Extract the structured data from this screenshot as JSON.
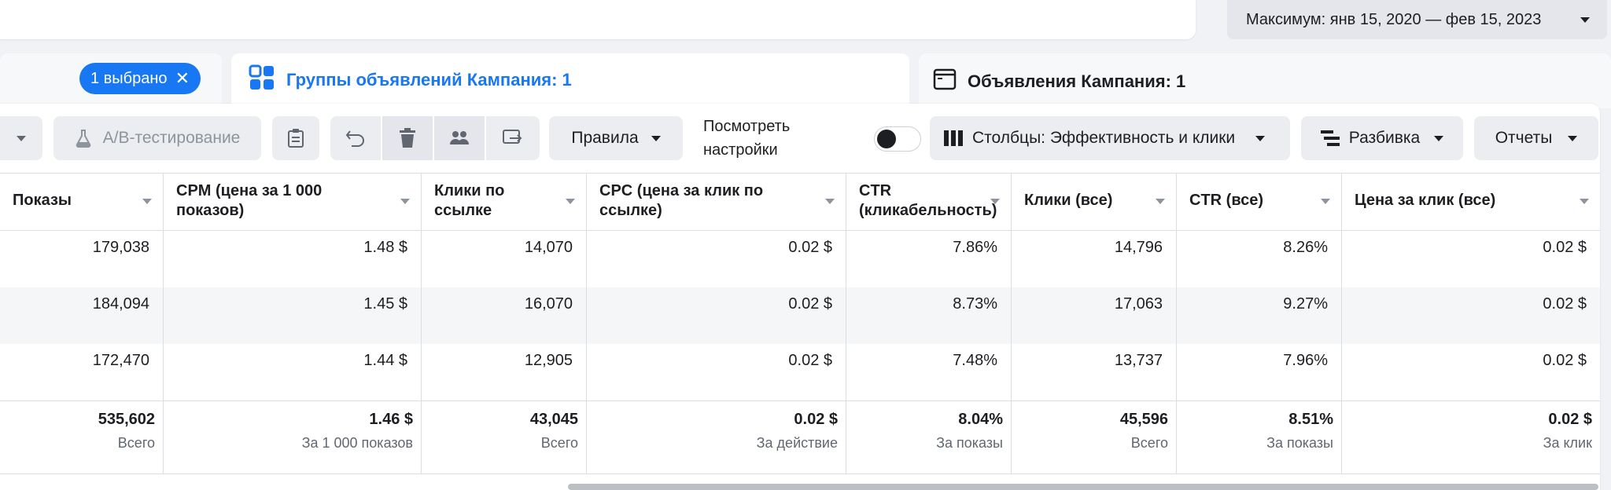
{
  "date_range": {
    "label": "Максимум: янв 15, 2020 — фев 15, 2023"
  },
  "tabs": {
    "campaigns": {
      "chip_label": "1 выбрано",
      "chip_close": "✕"
    },
    "adsets": {
      "title": "Группы объявлений Кампания: 1",
      "icon": "grid-icon"
    },
    "ads": {
      "title": "Объявления Кампания: 1",
      "icon": "window-icon"
    }
  },
  "toolbar": {
    "ab_test_label": "A/B-тестирование",
    "rules_label": "Правила",
    "view_settings_label_1": "Посмотреть",
    "view_settings_label_2": "настройки",
    "columns_label": "Столбцы: Эффективность и клики",
    "breakdown_label": "Разбивка",
    "reports_label": "Отчеты"
  },
  "table": {
    "columns": [
      "Показы",
      "CPM (цена за 1 000 показов)",
      "Клики по ссылке",
      "CPC (цена за клик по ссылке)",
      "CTR (кликабельность)",
      "Клики (все)",
      "CTR (все)",
      "Цена за клик (все)"
    ],
    "rows": [
      [
        "179,038",
        "1.48 $",
        "14,070",
        "0.02 $",
        "7.86%",
        "14,796",
        "8.26%",
        "0.02 $"
      ],
      [
        "184,094",
        "1.45 $",
        "16,070",
        "0.02 $",
        "8.73%",
        "17,063",
        "9.27%",
        "0.02 $"
      ],
      [
        "172,470",
        "1.44 $",
        "12,905",
        "0.02 $",
        "7.48%",
        "13,737",
        "7.96%",
        "0.02 $"
      ]
    ],
    "totals": [
      {
        "value": "535,602",
        "sub": "Всего"
      },
      {
        "value": "1.46 $",
        "sub": "За 1 000 показов"
      },
      {
        "value": "43,045",
        "sub": "Всего"
      },
      {
        "value": "0.02 $",
        "sub": "За действие"
      },
      {
        "value": "8.04%",
        "sub": "За показы"
      },
      {
        "value": "45,596",
        "sub": "Всего"
      },
      {
        "value": "8.51%",
        "sub": "За показы"
      },
      {
        "value": "0.02 $",
        "sub": "За клик"
      }
    ]
  },
  "colors": {
    "accent": "#1877f2",
    "toolbar_bg": "#ebedf0"
  }
}
